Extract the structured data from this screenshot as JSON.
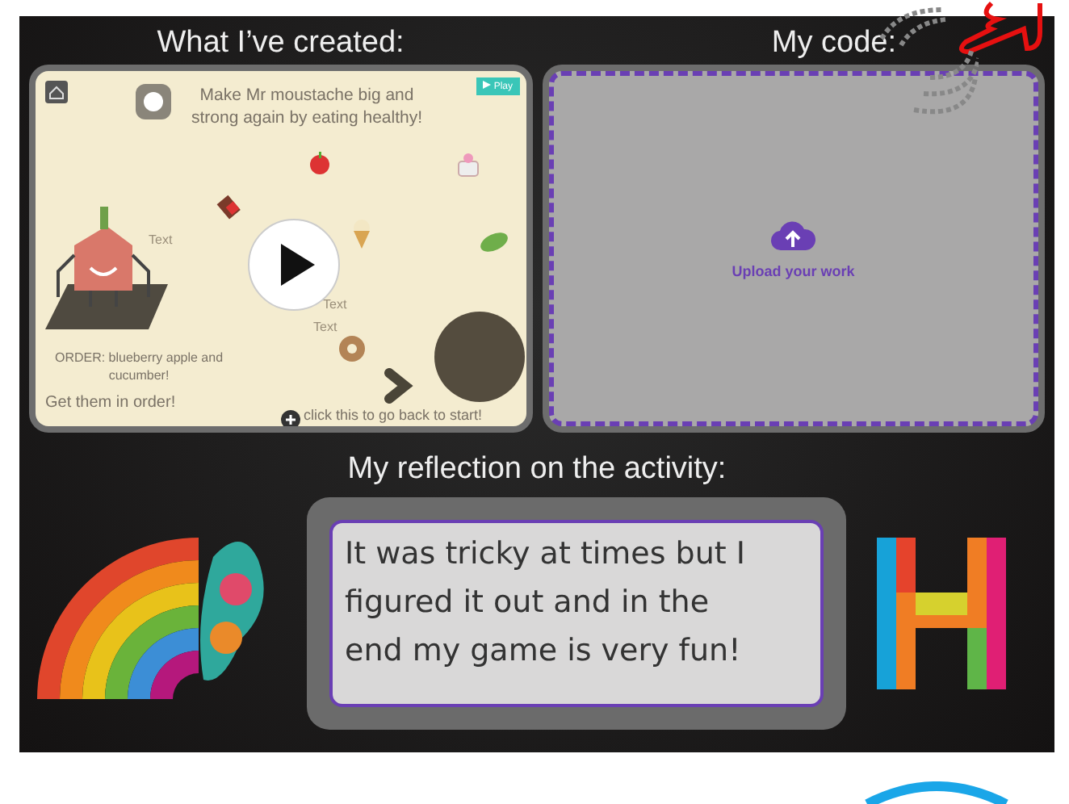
{
  "created": {
    "title": "What I’ve created:",
    "game": {
      "instruction": "Make Mr moustache big and strong again by eating healthy!",
      "play_button": "Play",
      "order": "ORDER: blueberry apple and cucumber!",
      "hint": "Get them in order!",
      "back": "click this to go back to start!",
      "labels": [
        "Text",
        "Text",
        "Text"
      ]
    }
  },
  "code": {
    "title": "My code:",
    "upload": "Upload your work"
  },
  "reflection": {
    "title": "My reflection on the activity:",
    "text": "It was tricky at times but I figured it out and in the end my game is very fun!"
  }
}
